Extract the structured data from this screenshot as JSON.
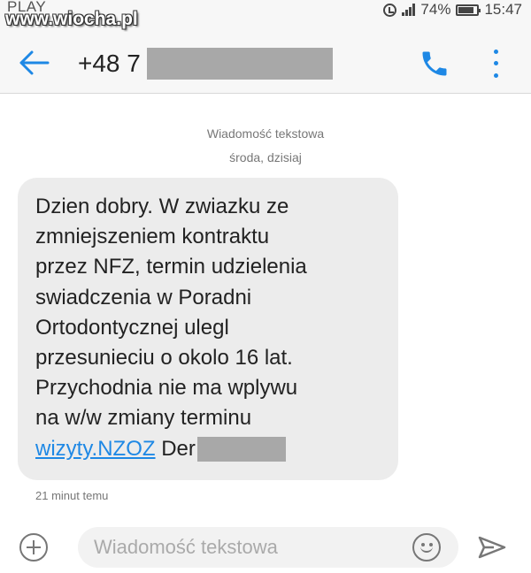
{
  "status_bar": {
    "carrier": "PLAY",
    "watermark": "www.wiocha.pl",
    "battery": "74%",
    "time": "15:47"
  },
  "header": {
    "phone_number": "+48 7"
  },
  "conversation": {
    "type_label": "Wiadomość tekstowa",
    "date_label": "środa, dzisiaj"
  },
  "message": {
    "lines": [
      "Dzien dobry. W zwiazku ze",
      "zmniejszeniem kontraktu",
      "przez NFZ, termin udzielenia",
      "swiadczenia w Poradni",
      "Ortodontycznej ulegl",
      "przesunieciu o okolo 16 lat.",
      "Przychodnia nie ma wplywu",
      "na w/w zmiany terminu"
    ],
    "link_text": "wizyty.NZOZ",
    "tail_text": "Der",
    "time_ago": "21 minut temu"
  },
  "compose": {
    "placeholder": "Wiadomość tekstowa"
  },
  "colors": {
    "accent": "#1e88e5",
    "bubble": "#ececec",
    "redaction": "#a8a8a8"
  },
  "icons": [
    "alarm-icon",
    "signal-icon",
    "battery-icon",
    "back-arrow-icon",
    "phone-icon",
    "more-vertical-icon",
    "add-icon",
    "emoji-icon",
    "send-icon"
  ]
}
